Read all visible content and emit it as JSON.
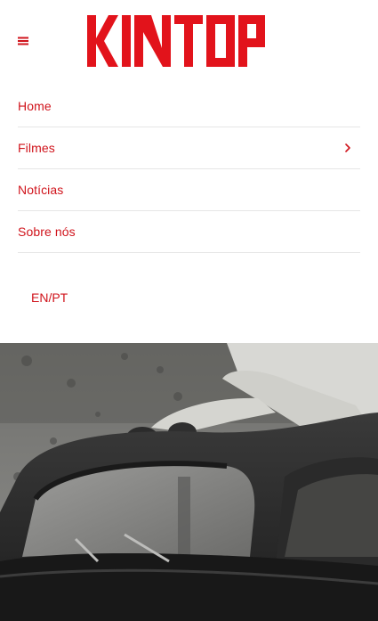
{
  "header": {
    "menu_icon": "hamburger-menu-icon",
    "logo_text": "KINTOP",
    "brand_color": "#d0141c"
  },
  "nav": {
    "items": [
      {
        "label": "Home",
        "has_submenu": false
      },
      {
        "label": "Filmes",
        "has_submenu": true,
        "icon": "chevron-right-icon"
      },
      {
        "label": "Notícias",
        "has_submenu": false
      },
      {
        "label": "Sobre nós",
        "has_submenu": false
      }
    ],
    "language_switch": "EN/PT"
  },
  "hero": {
    "image": "black-and-white photo of a person sitting on the roof of a vintage car"
  }
}
